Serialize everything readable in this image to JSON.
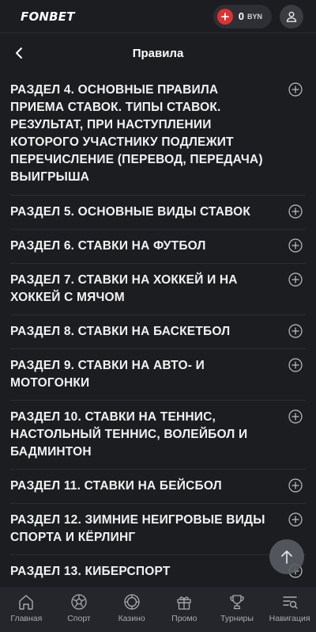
{
  "header": {
    "logo": "FONBET",
    "balance_amount": "0",
    "balance_currency": "BYN"
  },
  "titlebar": {
    "title": "Правила"
  },
  "sections": [
    {
      "label": "РАЗДЕЛ 4. ОСНОВНЫЕ ПРАВИЛА ПРИЕМА СТАВОК. ТИПЫ СТАВОК. РЕЗУЛЬТАТ, ПРИ НАСТУПЛЕНИИ КОТОРОГО УЧАСТНИКУ ПОДЛЕЖИТ ПЕРЕЧИСЛЕНИЕ (ПЕРЕВОД, ПЕРЕДАЧА) ВЫИГРЫША"
    },
    {
      "label": "РАЗДЕЛ 5. ОСНОВНЫЕ ВИДЫ СТАВОК"
    },
    {
      "label": "РАЗДЕЛ 6. СТАВКИ НА ФУТБОЛ"
    },
    {
      "label": "РАЗДЕЛ 7. СТАВКИ НА ХОККЕЙ И НА ХОККЕЙ С МЯЧОМ"
    },
    {
      "label": "РАЗДЕЛ 8. СТАВКИ НА БАСКЕТБОЛ"
    },
    {
      "label": "РАЗДЕЛ 9. СТАВКИ НА АВТО- И МОТОГОНКИ"
    },
    {
      "label": "РАЗДЕЛ 10. СТАВКИ НА ТЕННИС, НАСТОЛЬНЫЙ ТЕННИС, ВОЛЕЙБОЛ И БАДМИНТОН"
    },
    {
      "label": "РАЗДЕЛ 11. СТАВКИ НА БЕЙСБОЛ"
    },
    {
      "label": "РАЗДЕЛ 12. ЗИМНИЕ НЕИГРОВЫЕ ВИДЫ СПОРТА И КЁРЛИНГ"
    },
    {
      "label": "РАЗДЕЛ 13. КИБЕРСПОРТ"
    }
  ],
  "bottom_nav": [
    {
      "label": "Главная",
      "icon": "home-icon"
    },
    {
      "label": "Спорт",
      "icon": "soccer-ball-icon"
    },
    {
      "label": "Казино",
      "icon": "casino-chip-icon"
    },
    {
      "label": "Промо",
      "icon": "gift-icon"
    },
    {
      "label": "Турниры",
      "icon": "trophy-icon"
    },
    {
      "label": "Навигация",
      "icon": "menu-search-icon"
    }
  ],
  "colors": {
    "background": "#1c1d21",
    "accent_red": "#e03131",
    "nav_background": "#25262b"
  }
}
